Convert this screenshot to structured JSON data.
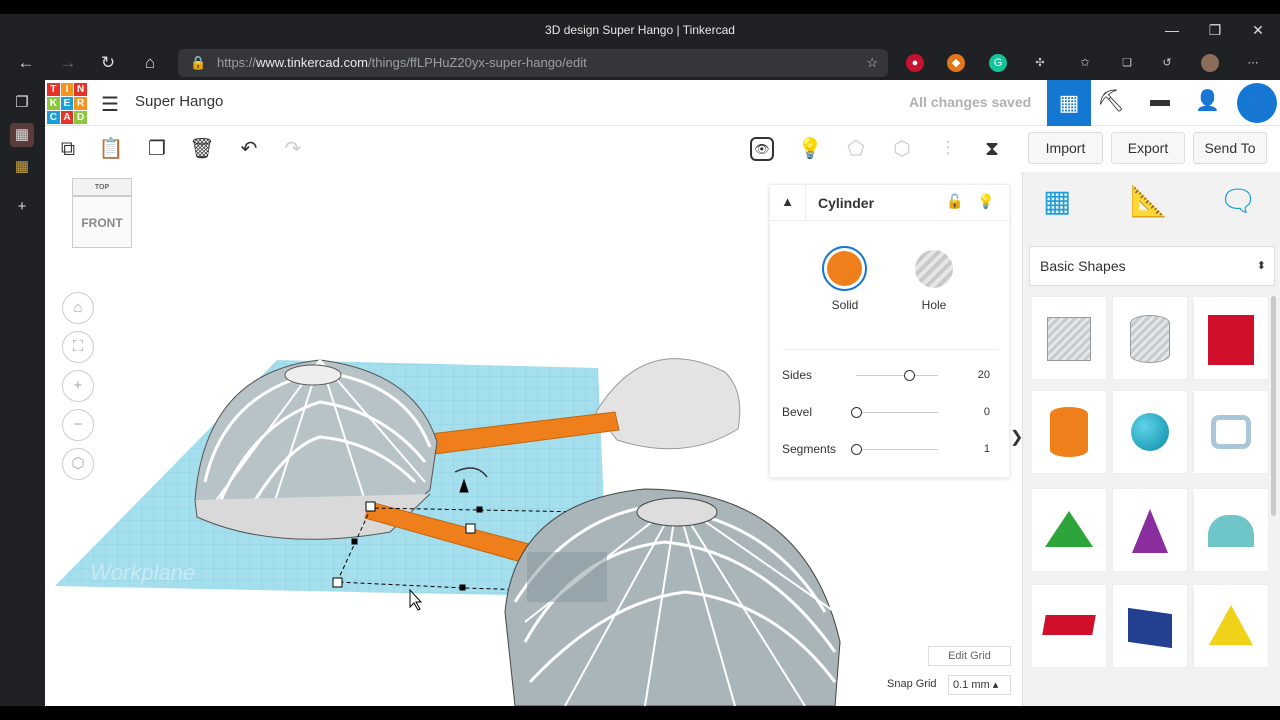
{
  "browser": {
    "window_title": "3D design Super Hango | Tinkercad",
    "url_prefix": "https://",
    "url_domain": "www.tinkercad.com",
    "url_path": "/things/ffLPHuZ20yx-super-hango/edit",
    "win_min": "—",
    "win_max": "❐",
    "win_close": "✕"
  },
  "header": {
    "logo_letters": [
      "T",
      "I",
      "N",
      "K",
      "E",
      "R",
      "C",
      "A",
      "D"
    ],
    "project_title": "Super Hango",
    "save_status": "All changes saved"
  },
  "toolbar": {
    "import": "Import",
    "export": "Export",
    "send_to": "Send To"
  },
  "canvas": {
    "view_cube_top": "TOP",
    "view_cube_front": "FRONT",
    "workplane": "Workplane",
    "edit_grid": "Edit Grid",
    "snap_grid_label": "Snap Grid",
    "snap_grid_value": "0.1 mm"
  },
  "inspector": {
    "title": "Cylinder",
    "solid_label": "Solid",
    "hole_label": "Hole",
    "solid_color": "#ef7f1a",
    "properties": [
      {
        "label": "Sides",
        "value": "20",
        "fraction": 0.65
      },
      {
        "label": "Bevel",
        "value": "0",
        "fraction": 0.0
      },
      {
        "label": "Segments",
        "value": "1",
        "fraction": 0.0
      }
    ]
  },
  "panel": {
    "category": "Basic Shapes",
    "collapse": "❯"
  },
  "colors": {
    "accent": "#1477d1",
    "workplane": "#9fdcea",
    "orange": "#ef7f1a"
  }
}
